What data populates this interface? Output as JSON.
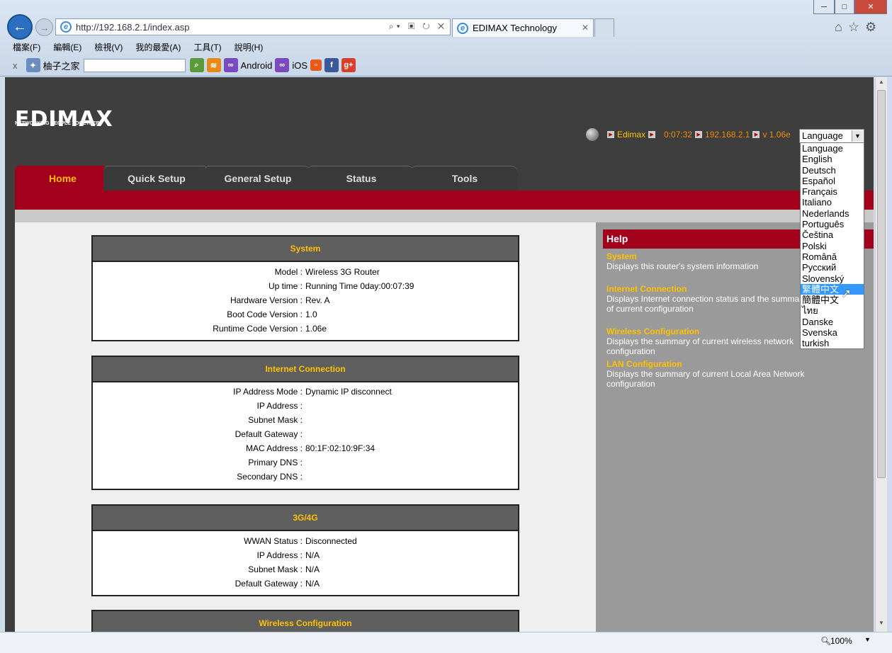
{
  "browser": {
    "address_url": "http://192.168.2.1/index.asp",
    "tab_title": "EDIMAX Technology",
    "window_controls": [
      "─",
      "□",
      "✕"
    ],
    "menu": [
      "檔案(F)",
      "編輯(E)",
      "檢視(V)",
      "我的最愛(A)",
      "工具(T)",
      "說明(H)"
    ],
    "favorites": {
      "close": "x",
      "site_label": "柚子之家",
      "search_value": "",
      "android_label": "Android",
      "ios_label": "iOS"
    },
    "zoom": "100%"
  },
  "header": {
    "logo": "EDIMAX",
    "tagline": "NETWORKING PEOPLE TOGETHER",
    "user": "Edimax",
    "time": "0:07:32",
    "ip": "192.168.2.1",
    "version": "v 1.06e",
    "language_selected": "Language"
  },
  "nav_tabs": [
    "Home",
    "Quick Setup",
    "General Setup",
    "Status",
    "Tools"
  ],
  "system": {
    "title": "System",
    "rows": [
      {
        "k": "Model :",
        "v": "Wireless 3G Router"
      },
      {
        "k": "Up time :",
        "v": "Running Time 0day:00:07:39"
      },
      {
        "k": "Hardware Version :",
        "v": "Rev. A"
      },
      {
        "k": "Boot Code Version :",
        "v": "1.0"
      },
      {
        "k": "Runtime Code Version :",
        "v": "1.06e"
      }
    ]
  },
  "internet": {
    "title": "Internet Connection",
    "rows": [
      {
        "k": "IP Address Mode :",
        "v": "Dynamic IP disconnect"
      },
      {
        "k": "IP Address :",
        "v": ""
      },
      {
        "k": "Subnet Mask :",
        "v": ""
      },
      {
        "k": "Default Gateway :",
        "v": ""
      },
      {
        "k": "MAC Address :",
        "v": "80:1F:02:10:9F:34"
      },
      {
        "k": "Primary DNS :",
        "v": ""
      },
      {
        "k": "Secondary DNS :",
        "v": ""
      }
    ]
  },
  "wwan": {
    "title": "3G/4G",
    "rows": [
      {
        "k": "WWAN Status :",
        "v": "Disconnected"
      },
      {
        "k": "IP Address :",
        "v": "N/A"
      },
      {
        "k": "Subnet Mask :",
        "v": "N/A"
      },
      {
        "k": "Default Gateway :",
        "v": "N/A"
      }
    ]
  },
  "wireless": {
    "title": "Wireless Configuration"
  },
  "help": {
    "title": "Help",
    "items": [
      {
        "t": "System",
        "d": "Displays this router's system information"
      },
      {
        "t": "Internet Connection",
        "d": "Displays Internet connection status and the summary of current configuration"
      },
      {
        "t": "Wireless Configuration",
        "d": "Displays the summary of current wireless network configuration"
      },
      {
        "t": "LAN Configuration",
        "d": "Displays the summary of current Local Area Network configuration"
      }
    ]
  },
  "language_options": [
    "Language",
    "English",
    "Deutsch",
    "Español",
    "Français",
    "Italiano",
    "Nederlands",
    "Português",
    "Čeština",
    "Polski",
    "Română",
    "Русский",
    "Slovenský",
    "繁體中文",
    "簡體中文",
    "ไทย",
    "Danske",
    "Svenska",
    "turkish"
  ],
  "language_highlighted": "繁體中文",
  "colors": {
    "accent_red": "#a3001b",
    "header_yellow": "#ffc000",
    "info_orange": "#f08c00"
  }
}
